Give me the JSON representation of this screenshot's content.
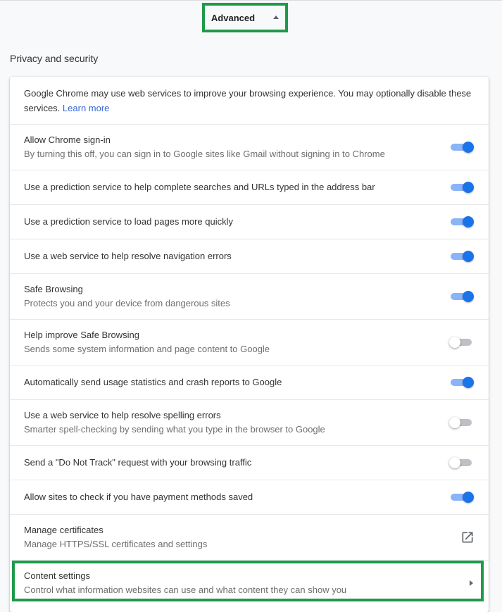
{
  "advanced": {
    "label": "Advanced",
    "icon": "caret-up-icon"
  },
  "section": {
    "title": "Privacy and security"
  },
  "intro": {
    "text": "Google Chrome may use web services to improve your browsing experience. You may optionally disable these services.",
    "link": "Learn more"
  },
  "rows": [
    {
      "primary": "Allow Chrome sign-in",
      "secondary": "By turning this off, you can sign in to Google sites like Gmail without signing in to Chrome",
      "control": "toggle",
      "on": true
    },
    {
      "primary": "Use a prediction service to help complete searches and URLs typed in the address bar",
      "secondary": "",
      "control": "toggle",
      "on": true
    },
    {
      "primary": "Use a prediction service to load pages more quickly",
      "secondary": "",
      "control": "toggle",
      "on": true
    },
    {
      "primary": "Use a web service to help resolve navigation errors",
      "secondary": "",
      "control": "toggle",
      "on": true
    },
    {
      "primary": "Safe Browsing",
      "secondary": "Protects you and your device from dangerous sites",
      "control": "toggle",
      "on": true
    },
    {
      "primary": "Help improve Safe Browsing",
      "secondary": "Sends some system information and page content to Google",
      "control": "toggle",
      "on": false
    },
    {
      "primary": "Automatically send usage statistics and crash reports to Google",
      "secondary": "",
      "control": "toggle",
      "on": true
    },
    {
      "primary": "Use a web service to help resolve spelling errors",
      "secondary": "Smarter spell-checking by sending what you type in the browser to Google",
      "control": "toggle",
      "on": false
    },
    {
      "primary": "Send a \"Do Not Track\" request with your browsing traffic",
      "secondary": "",
      "control": "toggle",
      "on": false
    },
    {
      "primary": "Allow sites to check if you have payment methods saved",
      "secondary": "",
      "control": "toggle",
      "on": true
    },
    {
      "primary": "Manage certificates",
      "secondary": "Manage HTTPS/SSL certificates and settings",
      "control": "external",
      "icon": "external-link-icon"
    },
    {
      "primary": "Content settings",
      "secondary": "Control what information websites can use and what content they can show you",
      "control": "chevron",
      "icon": "chevron-right-icon"
    }
  ],
  "colors": {
    "accent": "#1a73e8",
    "toggle_track_on": "#8ab4f8",
    "toggle_track_off": "#bdc1c6",
    "link": "#3367d6",
    "highlight": "#1e9a4a"
  }
}
